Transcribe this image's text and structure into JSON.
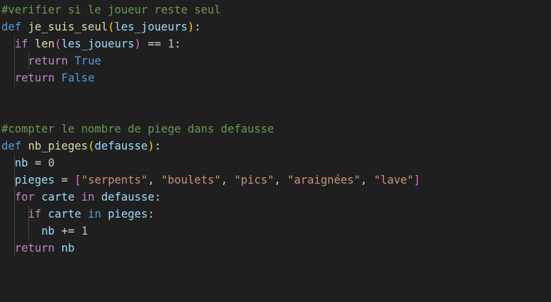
{
  "editor": {
    "theme": {
      "background": "#1f1f1f",
      "keyword": "#569cd6",
      "control": "#c586c0",
      "function": "#dcdcaa",
      "variable": "#9cdcfe",
      "string": "#ce9178",
      "number": "#b5cea8",
      "comment": "#6a9955",
      "bracket1": "#ffd700",
      "bracket2": "#da70d6"
    },
    "lines": [
      {
        "id": "l1",
        "tokens": [
          {
            "t": "#verifier si le joueur reste seul",
            "c": "cmt"
          }
        ]
      },
      {
        "id": "l2",
        "tokens": [
          {
            "t": "def",
            "c": "kw"
          },
          {
            "t": " ",
            "c": "op"
          },
          {
            "t": "je_suis_seul",
            "c": "fn"
          },
          {
            "t": "(",
            "c": "b1"
          },
          {
            "t": "les_joueurs",
            "c": "prm"
          },
          {
            "t": ")",
            "c": "b1"
          },
          {
            "t": ":",
            "c": "op"
          }
        ]
      },
      {
        "id": "l3",
        "tokens": [
          {
            "t": "  ",
            "c": "op"
          },
          {
            "t": "if",
            "c": "ctl"
          },
          {
            "t": " ",
            "c": "op"
          },
          {
            "t": "len",
            "c": "fn"
          },
          {
            "t": "(",
            "c": "b2"
          },
          {
            "t": "les_joueurs",
            "c": "var"
          },
          {
            "t": ")",
            "c": "b2"
          },
          {
            "t": " == ",
            "c": "op"
          },
          {
            "t": "1",
            "c": "num"
          },
          {
            "t": ":",
            "c": "op"
          }
        ]
      },
      {
        "id": "l4",
        "tokens": [
          {
            "t": "    ",
            "c": "op"
          },
          {
            "t": "return",
            "c": "ctl"
          },
          {
            "t": " ",
            "c": "op"
          },
          {
            "t": "True",
            "c": "const"
          }
        ]
      },
      {
        "id": "l5",
        "tokens": [
          {
            "t": "  ",
            "c": "op"
          },
          {
            "t": "return",
            "c": "ctl"
          },
          {
            "t": " ",
            "c": "op"
          },
          {
            "t": "False",
            "c": "const"
          }
        ]
      },
      {
        "id": "l6",
        "tokens": []
      },
      {
        "id": "l7",
        "tokens": []
      },
      {
        "id": "l8",
        "tokens": [
          {
            "t": "#compter le nombre de piege dans defausse",
            "c": "cmt"
          }
        ]
      },
      {
        "id": "l9",
        "tokens": [
          {
            "t": "def",
            "c": "kw"
          },
          {
            "t": " ",
            "c": "op"
          },
          {
            "t": "nb_pieges",
            "c": "fn"
          },
          {
            "t": "(",
            "c": "b1"
          },
          {
            "t": "defausse",
            "c": "prm"
          },
          {
            "t": ")",
            "c": "b1"
          },
          {
            "t": ":",
            "c": "op"
          }
        ]
      },
      {
        "id": "l10",
        "tokens": [
          {
            "t": "  ",
            "c": "op"
          },
          {
            "t": "nb",
            "c": "var"
          },
          {
            "t": " = ",
            "c": "op"
          },
          {
            "t": "0",
            "c": "num"
          }
        ]
      },
      {
        "id": "l11",
        "tokens": [
          {
            "t": "  ",
            "c": "op"
          },
          {
            "t": "pieges",
            "c": "var"
          },
          {
            "t": " = ",
            "c": "op"
          },
          {
            "t": "[",
            "c": "b2"
          },
          {
            "t": "\"serpents\"",
            "c": "str"
          },
          {
            "t": ", ",
            "c": "op"
          },
          {
            "t": "\"boulets\"",
            "c": "str"
          },
          {
            "t": ", ",
            "c": "op"
          },
          {
            "t": "\"pics\"",
            "c": "str"
          },
          {
            "t": ", ",
            "c": "op"
          },
          {
            "t": "\"araignées\"",
            "c": "str"
          },
          {
            "t": ", ",
            "c": "op"
          },
          {
            "t": "\"lave\"",
            "c": "str"
          },
          {
            "t": "]",
            "c": "b2"
          }
        ]
      },
      {
        "id": "l12",
        "tokens": [
          {
            "t": "  ",
            "c": "op"
          },
          {
            "t": "for",
            "c": "ctl"
          },
          {
            "t": " ",
            "c": "op"
          },
          {
            "t": "carte",
            "c": "var"
          },
          {
            "t": " ",
            "c": "op"
          },
          {
            "t": "in",
            "c": "ctl"
          },
          {
            "t": " ",
            "c": "op"
          },
          {
            "t": "defausse",
            "c": "var"
          },
          {
            "t": ":",
            "c": "op"
          }
        ]
      },
      {
        "id": "l13",
        "tokens": [
          {
            "t": "    ",
            "c": "op"
          },
          {
            "t": "if",
            "c": "ctl"
          },
          {
            "t": " ",
            "c": "op"
          },
          {
            "t": "carte",
            "c": "var"
          },
          {
            "t": " ",
            "c": "op"
          },
          {
            "t": "in",
            "c": "kw"
          },
          {
            "t": " ",
            "c": "op"
          },
          {
            "t": "pieges",
            "c": "var"
          },
          {
            "t": ":",
            "c": "op"
          }
        ]
      },
      {
        "id": "l14",
        "tokens": [
          {
            "t": "      ",
            "c": "op"
          },
          {
            "t": "nb",
            "c": "var"
          },
          {
            "t": " += ",
            "c": "op"
          },
          {
            "t": "1",
            "c": "num"
          }
        ]
      },
      {
        "id": "l15",
        "tokens": [
          {
            "t": "  ",
            "c": "op"
          },
          {
            "t": "return",
            "c": "ctl"
          },
          {
            "t": " ",
            "c": "op"
          },
          {
            "t": "nb",
            "c": "var"
          }
        ]
      }
    ]
  }
}
